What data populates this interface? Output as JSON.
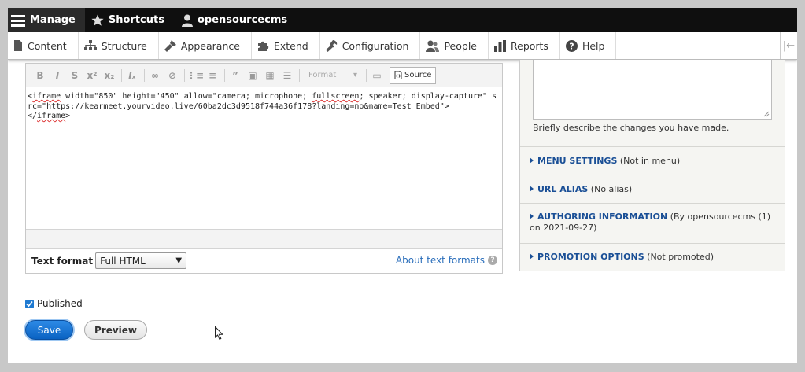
{
  "toolbar": {
    "items": [
      {
        "label": "Manage"
      },
      {
        "label": "Shortcuts"
      },
      {
        "label": "opensourcecms"
      }
    ]
  },
  "tray": {
    "tabs": [
      {
        "label": "Content"
      },
      {
        "label": "Structure"
      },
      {
        "label": "Appearance"
      },
      {
        "label": "Extend"
      },
      {
        "label": "Configuration"
      },
      {
        "label": "People"
      },
      {
        "label": "Reports"
      },
      {
        "label": "Help"
      }
    ]
  },
  "editor": {
    "format_dropdown": "Format",
    "source_label": "Source",
    "code": {
      "t1": "<",
      "t2": "iframe",
      "t3": " width=\"850\" height=\"450\" allow=\"camera; microphone; ",
      "t4": "fullscreen",
      "t5": "; speaker; display-capture\" src=\"https://kearmeet.yourvideo.live/60ba2dc3d9518f744a36f178?landing=no&name=Test Embed\">\n</",
      "t6": "iframe",
      "t7": ">"
    },
    "text_format_label": "Text format",
    "text_format_value": "Full HTML",
    "about_link": "About text formats"
  },
  "published_label": "Published",
  "save_label": "Save",
  "preview_label": "Preview",
  "sidebar": {
    "revision_hint": "Briefly describe the changes you have made.",
    "details": [
      {
        "summary": "MENU SETTINGS",
        "note": "(Not in menu)"
      },
      {
        "summary": "URL ALIAS",
        "note": "(No alias)"
      },
      {
        "summary": "AUTHORING INFORMATION",
        "note": "(By opensourcecms (1) on 2021-09-27)"
      },
      {
        "summary": "PROMOTION OPTIONS",
        "note": "(Not promoted)"
      }
    ]
  },
  "colors": {
    "link": "#2a6ebb",
    "save": "#0a62c2",
    "toolbar": "#0f0f0f"
  }
}
